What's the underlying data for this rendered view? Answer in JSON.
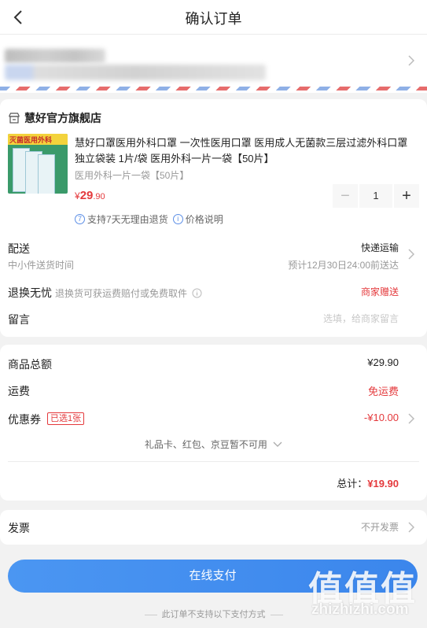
{
  "header": {
    "title": "确认订单"
  },
  "shop": {
    "name": "慧好官方旗舰店"
  },
  "product": {
    "image_label": "灭菌医用外科",
    "title": "慧好口罩医用外科口罩 一次性医用口罩 医用成人无菌款三层过滤外科口罩 独立袋装 1片/袋 医用外科一片一袋【50片】",
    "spec": "医用外科一片一袋【50片】",
    "price_symbol": "¥",
    "price_int": "29",
    "price_dec": ".90",
    "quantity": "1",
    "minus_label": "−",
    "plus_label": "+",
    "service_icon": "7",
    "service_text": "支持7天无理由退货",
    "price_info_icon": "i",
    "price_info_text": "价格说明"
  },
  "delivery": {
    "label": "配送",
    "sub": "中小件送货时间",
    "method": "快递运输",
    "eta": "预计12月30日24:00前送达"
  },
  "returns": {
    "label": "退换无忧",
    "desc": "退换货可获运费赔付或免费取件",
    "value": "商家赠送"
  },
  "note": {
    "label": "留言",
    "placeholder": "选填，给商家留言"
  },
  "summary": {
    "goods_label": "商品总额",
    "goods_value": "¥29.90",
    "shipping_label": "运费",
    "shipping_value": "免运费",
    "coupon_label": "优惠券",
    "coupon_tag": "已选1张",
    "coupon_value": "-¥10.00",
    "gift_note": "礼品卡、红包、京豆暂不可用",
    "total_label": "总计：",
    "total_value": "¥19.90"
  },
  "invoice": {
    "label": "发票",
    "value": "不开发票"
  },
  "pay_button": "在线支付",
  "footer_note": "此订单不支持以下支付方式",
  "watermark": {
    "glyphs": "值值值",
    "site": "zhizhizhi.com"
  },
  "colors": {
    "accent": "#e4393c",
    "primary": "#3b86ec",
    "background": "#f2f2f2"
  },
  "icons": [
    "back-arrow-icon",
    "store-icon",
    "chevron-right-icon",
    "info-icon",
    "chevron-down-icon"
  ]
}
